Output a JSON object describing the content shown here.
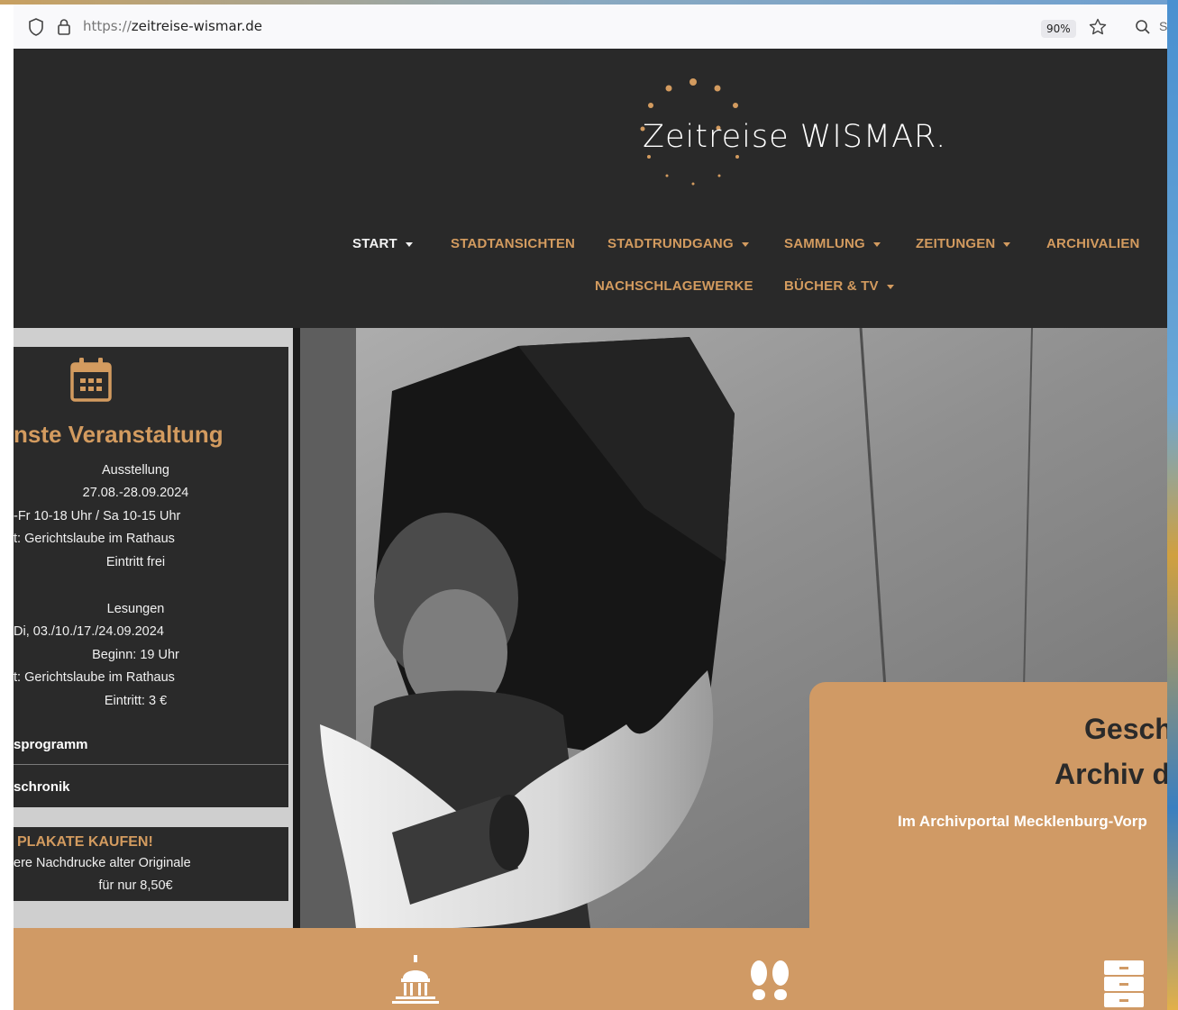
{
  "browser": {
    "url_scheme": "https://",
    "url_host": "zeitreise-wismar.de",
    "zoom": "90%",
    "search_truncated": "S"
  },
  "logo": {
    "text_main": "Zeitreise",
    "text_city": "WISMAR."
  },
  "nav": {
    "row1": [
      {
        "label": "START",
        "dropdown": true,
        "active": true
      },
      {
        "label": "STADTANSICHTEN",
        "dropdown": false
      },
      {
        "label": "STADTRUNDGANG",
        "dropdown": true
      },
      {
        "label": "SAMMLUNG",
        "dropdown": true
      },
      {
        "label": "ZEITUNGEN",
        "dropdown": true
      },
      {
        "label": "ARCHIVALIEN",
        "dropdown": false
      }
    ],
    "row2": [
      {
        "label": "NACHSCHLAGEWERKE",
        "dropdown": false
      },
      {
        "label": "BÜCHER & TV",
        "dropdown": true
      }
    ]
  },
  "event": {
    "icon": "calendar-icon",
    "title": "nste Veranstaltung",
    "lines1": [
      "Ausstellung",
      "27.08.-28.09.2024",
      "-Fr 10-18 Uhr / Sa 10-15 Uhr",
      "t: Gerichtslaube im Rathaus",
      "Eintritt frei"
    ],
    "lines2": [
      "Lesungen",
      "Di, 03./10./17./24.09.2024",
      "Beginn: 19 Uhr",
      "t: Gerichtslaube im Rathaus",
      "Eintritt: 3 €"
    ],
    "link_program": "sprogramm",
    "link_chronik": "schronik"
  },
  "poster": {
    "title": "PLAKATE KAUFEN!",
    "line1": "ere Nachdrucke alter Originale",
    "line2": "für nur 8,50€"
  },
  "archive": {
    "heading1": "Gesch",
    "heading2": "Archiv d",
    "subtitle": "Im Archivportal Mecklenburg-Vorp"
  },
  "bottom_icons": [
    "building-icon",
    "footprints-icon",
    "cabinet-icon"
  ],
  "colors": {
    "accent": "#d39b5f",
    "header_bg": "#292929",
    "panel_bg": "#2a2a2a",
    "band_bg": "#d09a65"
  }
}
